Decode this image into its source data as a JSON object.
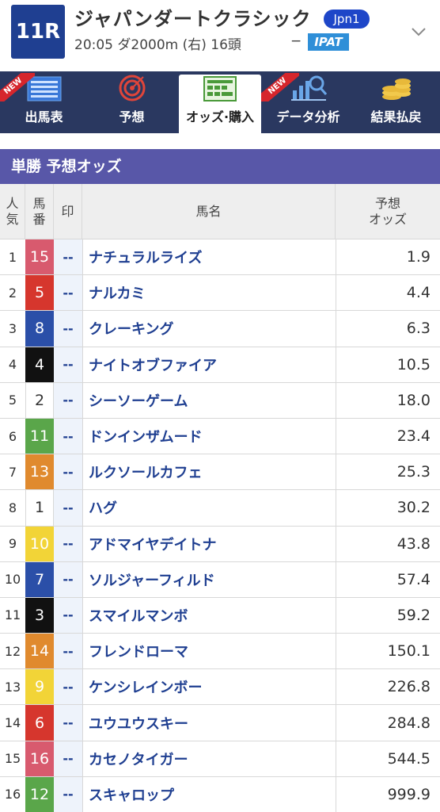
{
  "header": {
    "race_number": "11R",
    "race_name": "ジャパンダートクラシック",
    "grade": "Jpn1",
    "info": "20:05 ダ2000m (右) 16頭",
    "dash": "−",
    "ipat": "IPAT"
  },
  "nav": [
    {
      "label": "出馬表",
      "icon": "racecard-icon",
      "new": true,
      "new_label": "NEW",
      "active": false
    },
    {
      "label": "予想",
      "icon": "target-icon",
      "new": false,
      "active": false
    },
    {
      "label": "オッズ·購入",
      "icon": "odds-board-icon",
      "new": false,
      "active": true
    },
    {
      "label": "データ分析",
      "icon": "chart-magnifier-icon",
      "new": true,
      "new_label": "NEW",
      "active": false
    },
    {
      "label": "結果払戻",
      "icon": "coins-icon",
      "new": false,
      "active": false
    }
  ],
  "section_title": "単勝 予想オッズ",
  "table_headers": {
    "popularity": "人\n気",
    "horse_number": "馬\n番",
    "mark": "印",
    "horse_name": "馬名",
    "odds": "予想\nオッズ"
  },
  "colors": {
    "navy": "#1f3f91",
    "nav_bg": "#2a3860",
    "section": "#5857a8"
  },
  "rows": [
    {
      "pop": "1",
      "num": "15",
      "bg": "#d85a6e",
      "fg": "#ffffff",
      "mark": "--",
      "name": "ナチュラルライズ",
      "odds": "1.9"
    },
    {
      "pop": "2",
      "num": "5",
      "bg": "#d6362d",
      "fg": "#ffffff",
      "mark": "--",
      "name": "ナルカミ",
      "odds": "4.4"
    },
    {
      "pop": "3",
      "num": "8",
      "bg": "#2b4fa8",
      "fg": "#ffffff",
      "mark": "--",
      "name": "クレーキング",
      "odds": "6.3"
    },
    {
      "pop": "4",
      "num": "4",
      "bg": "#111111",
      "fg": "#ffffff",
      "mark": "--",
      "name": "ナイトオブファイア",
      "odds": "10.5"
    },
    {
      "pop": "5",
      "num": "2",
      "bg": "#ffffff",
      "fg": "#333333",
      "mark": "--",
      "name": "シーソーゲーム",
      "odds": "18.0"
    },
    {
      "pop": "6",
      "num": "11",
      "bg": "#5aa64a",
      "fg": "#ffffff",
      "mark": "--",
      "name": "ドンインザムード",
      "odds": "23.4"
    },
    {
      "pop": "7",
      "num": "13",
      "bg": "#e08a2e",
      "fg": "#ffffff",
      "mark": "--",
      "name": "ルクソールカフェ",
      "odds": "25.3"
    },
    {
      "pop": "8",
      "num": "1",
      "bg": "#ffffff",
      "fg": "#333333",
      "mark": "--",
      "name": "ハグ",
      "odds": "30.2"
    },
    {
      "pop": "9",
      "num": "10",
      "bg": "#f2d437",
      "fg": "#ffffff",
      "mark": "--",
      "name": "アドマイヤデイトナ",
      "odds": "43.8"
    },
    {
      "pop": "10",
      "num": "7",
      "bg": "#2b4fa8",
      "fg": "#ffffff",
      "mark": "--",
      "name": "ソルジャーフィルド",
      "odds": "57.4"
    },
    {
      "pop": "11",
      "num": "3",
      "bg": "#111111",
      "fg": "#ffffff",
      "mark": "--",
      "name": "スマイルマンボ",
      "odds": "59.2"
    },
    {
      "pop": "12",
      "num": "14",
      "bg": "#e08a2e",
      "fg": "#ffffff",
      "mark": "--",
      "name": "フレンドローマ",
      "odds": "150.1"
    },
    {
      "pop": "13",
      "num": "9",
      "bg": "#f2d437",
      "fg": "#ffffff",
      "mark": "--",
      "name": "ケンシレインボー",
      "odds": "226.8"
    },
    {
      "pop": "14",
      "num": "6",
      "bg": "#d6362d",
      "fg": "#ffffff",
      "mark": "--",
      "name": "ユウユウスキー",
      "odds": "284.8"
    },
    {
      "pop": "15",
      "num": "16",
      "bg": "#d85a6e",
      "fg": "#ffffff",
      "mark": "--",
      "name": "カセノタイガー",
      "odds": "544.5"
    },
    {
      "pop": "16",
      "num": "12",
      "bg": "#5aa64a",
      "fg": "#ffffff",
      "mark": "--",
      "name": "スキャロップ",
      "odds": "999.9"
    }
  ]
}
